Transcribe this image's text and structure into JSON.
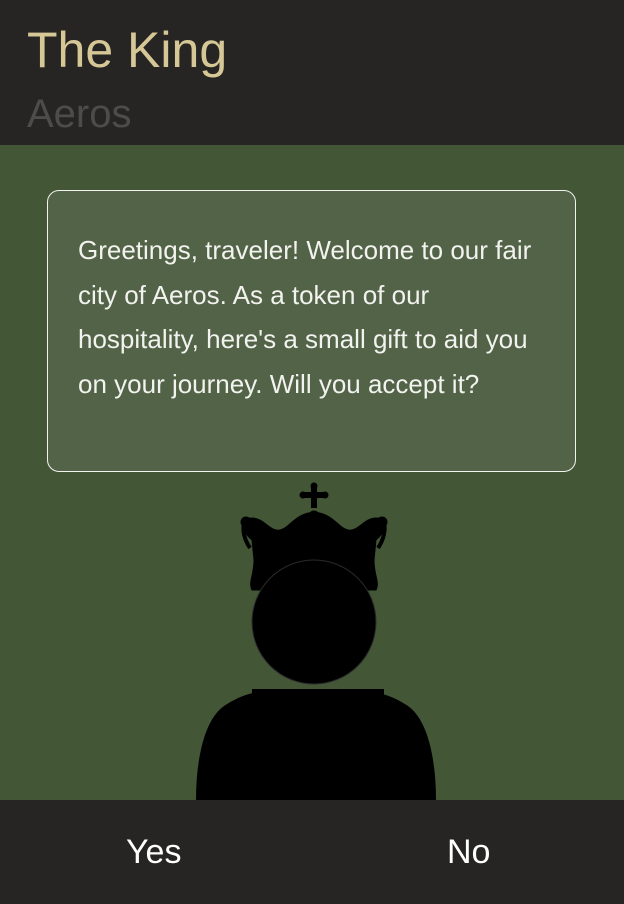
{
  "header": {
    "npc_name": "The King",
    "location": "Aeros"
  },
  "dialogue": {
    "text": "Greetings, traveler! Welcome to our fair city of Aeros. As a token of our hospitality, here's a small gift to aid you on your journey. Will you accept it?"
  },
  "portrait": {
    "icon": "king-silhouette-icon"
  },
  "choices": {
    "yes_label": "Yes",
    "no_label": "No"
  },
  "colors": {
    "header_bg": "#262523",
    "name_color": "#d6c796",
    "location_color": "#4d4c48",
    "scene_bg": "#435737",
    "dialogue_bg": "#526348",
    "text_color": "#f2f2ee"
  }
}
